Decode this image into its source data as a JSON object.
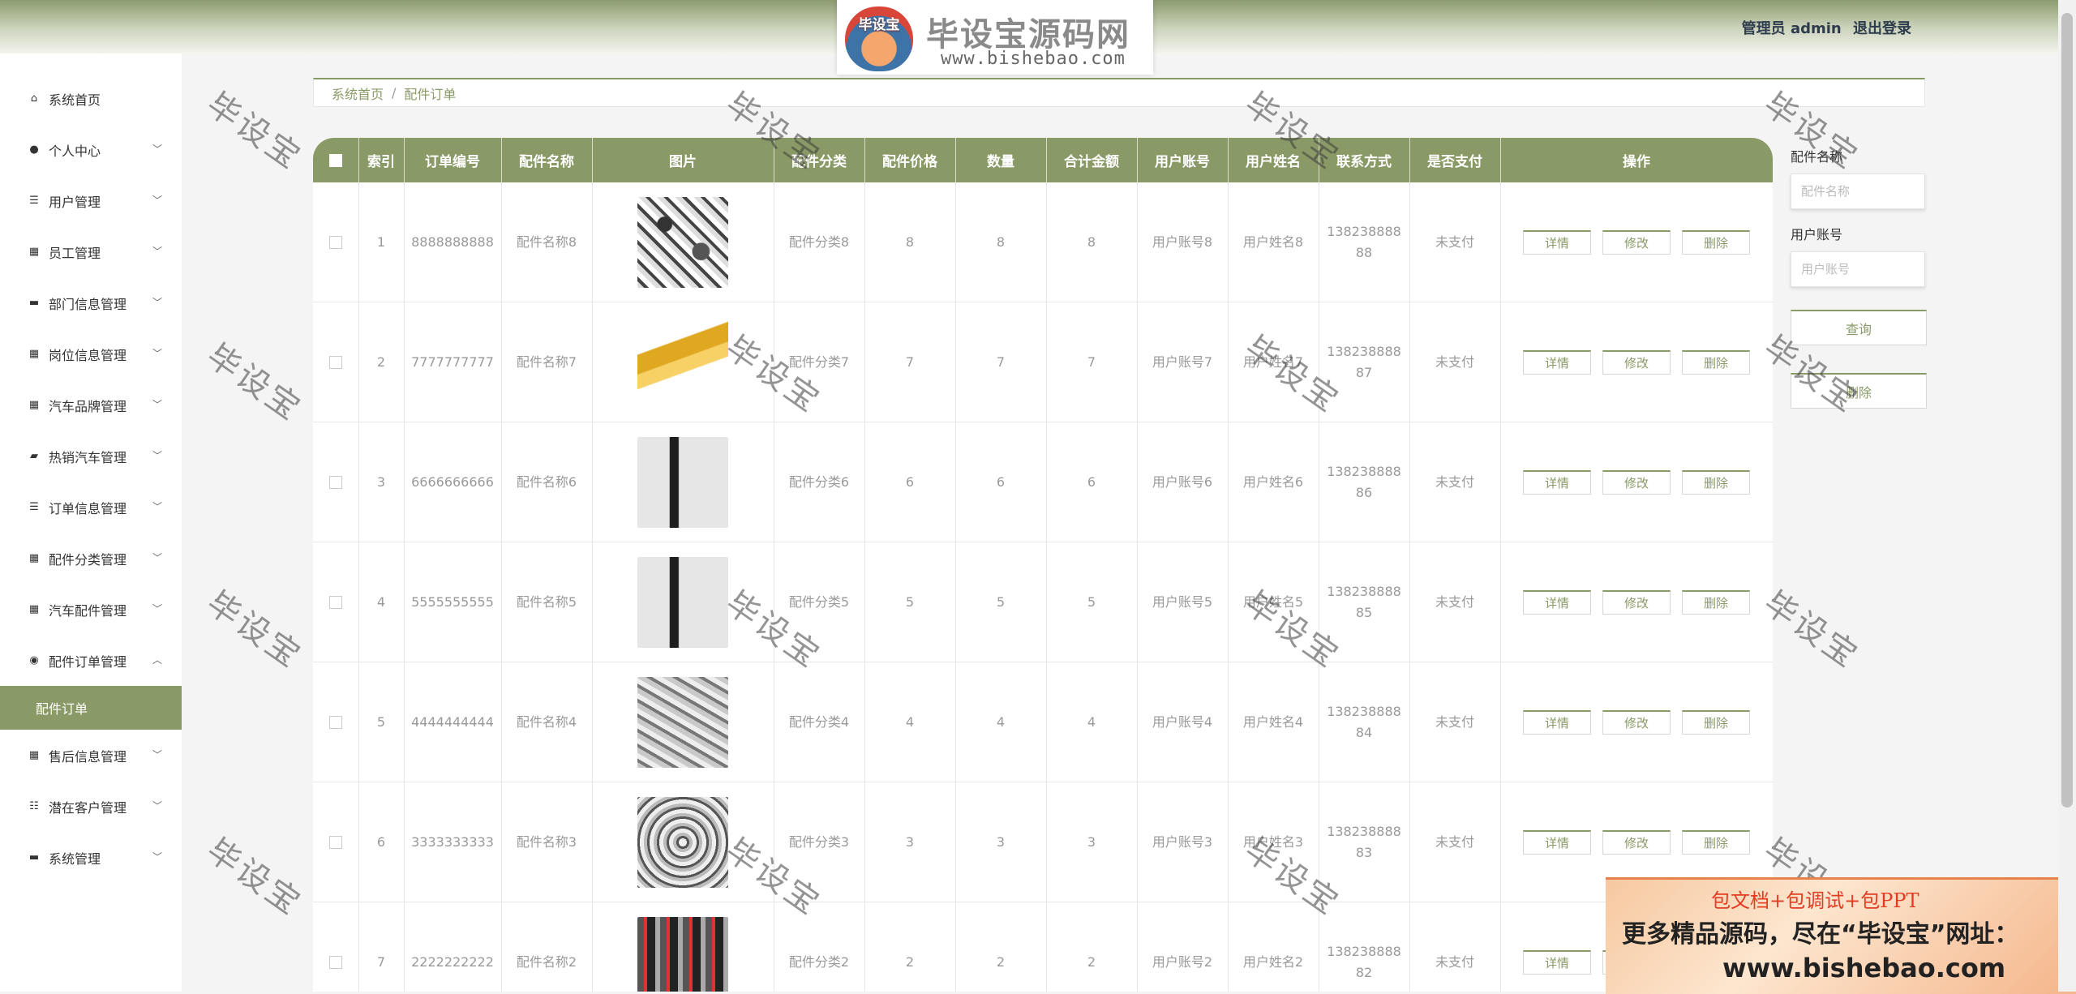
{
  "header": {
    "logo_badge": "毕设宝",
    "logo_title": "毕设宝源码网",
    "logo_url": "www.bishebao.com",
    "user_label": "管理员 admin",
    "logout_label": "退出登录"
  },
  "sidebar": {
    "items": [
      {
        "label": "系统首页",
        "icon": "home-icon",
        "glyph": "⌂",
        "chevron": false
      },
      {
        "label": "个人中心",
        "icon": "user-icon",
        "glyph": "●",
        "chevron": true
      },
      {
        "label": "用户管理",
        "icon": "list-icon",
        "glyph": "☰",
        "chevron": true
      },
      {
        "label": "员工管理",
        "icon": "chart-icon",
        "glyph": "▦",
        "chevron": true
      },
      {
        "label": "部门信息管理",
        "icon": "ticket-icon",
        "glyph": "▬",
        "chevron": true
      },
      {
        "label": "岗位信息管理",
        "icon": "grid-icon",
        "glyph": "▦",
        "chevron": true
      },
      {
        "label": "汽车品牌管理",
        "icon": "grid-icon",
        "glyph": "▦",
        "chevron": true
      },
      {
        "label": "热销汽车管理",
        "icon": "comment-icon",
        "glyph": "▰",
        "chevron": true
      },
      {
        "label": "订单信息管理",
        "icon": "list-icon",
        "glyph": "☰",
        "chevron": true
      },
      {
        "label": "配件分类管理",
        "icon": "grid-icon",
        "glyph": "▦",
        "chevron": true
      },
      {
        "label": "汽车配件管理",
        "icon": "grid-icon",
        "glyph": "▦",
        "chevron": true
      },
      {
        "label": "配件订单管理",
        "icon": "pin-icon",
        "glyph": "◉",
        "chevron": "up"
      }
    ],
    "active_sub": "配件订单",
    "items_after": [
      {
        "label": "售后信息管理",
        "icon": "grid-icon",
        "glyph": "▦",
        "chevron": true
      },
      {
        "label": "潜在客户管理",
        "icon": "sliders-icon",
        "glyph": "☷",
        "chevron": true
      },
      {
        "label": "系统管理",
        "icon": "flag-icon",
        "glyph": "▬",
        "chevron": true
      }
    ]
  },
  "breadcrumb": {
    "home": "系统首页",
    "separator": "/",
    "current": "配件订单"
  },
  "table": {
    "headers": [
      "索引",
      "订单编号",
      "配件名称",
      "图片",
      "配件分类",
      "配件价格",
      "数量",
      "合计金额",
      "用户账号",
      "用户姓名",
      "联系方式",
      "是否支付",
      "操作"
    ],
    "rows": [
      {
        "index": "1",
        "order_no": "8888888888",
        "name": "配件名称8",
        "image": "t1",
        "category": "配件分类8",
        "price": "8",
        "qty": "8",
        "total": "8",
        "account": "用户账号8",
        "username": "用户姓名8",
        "phone1": "138238888",
        "phone2": "88",
        "paid": "未支付"
      },
      {
        "index": "2",
        "order_no": "7777777777",
        "name": "配件名称7",
        "image": "t2",
        "category": "配件分类7",
        "price": "7",
        "qty": "7",
        "total": "7",
        "account": "用户账号7",
        "username": "用户姓名7",
        "phone1": "138238888",
        "phone2": "87",
        "paid": "未支付"
      },
      {
        "index": "3",
        "order_no": "6666666666",
        "name": "配件名称6",
        "image": "t3",
        "category": "配件分类6",
        "price": "6",
        "qty": "6",
        "total": "6",
        "account": "用户账号6",
        "username": "用户姓名6",
        "phone1": "138238888",
        "phone2": "86",
        "paid": "未支付"
      },
      {
        "index": "4",
        "order_no": "5555555555",
        "name": "配件名称5",
        "image": "t4",
        "category": "配件分类5",
        "price": "5",
        "qty": "5",
        "total": "5",
        "account": "用户账号5",
        "username": "用户姓名5",
        "phone1": "138238888",
        "phone2": "85",
        "paid": "未支付"
      },
      {
        "index": "5",
        "order_no": "4444444444",
        "name": "配件名称4",
        "image": "t5",
        "category": "配件分类4",
        "price": "4",
        "qty": "4",
        "total": "4",
        "account": "用户账号4",
        "username": "用户姓名4",
        "phone1": "138238888",
        "phone2": "84",
        "paid": "未支付"
      },
      {
        "index": "6",
        "order_no": "3333333333",
        "name": "配件名称3",
        "image": "t6",
        "category": "配件分类3",
        "price": "3",
        "qty": "3",
        "total": "3",
        "account": "用户账号3",
        "username": "用户姓名3",
        "phone1": "138238888",
        "phone2": "83",
        "paid": "未支付"
      },
      {
        "index": "7",
        "order_no": "2222222222",
        "name": "配件名称2",
        "image": "t7",
        "category": "配件分类2",
        "price": "2",
        "qty": "2",
        "total": "2",
        "account": "用户账号2",
        "username": "用户姓名2",
        "phone1": "138238888",
        "phone2": "82",
        "paid": "未支付"
      }
    ],
    "actions": {
      "detail": "详情",
      "edit": "修改",
      "delete": "删除"
    }
  },
  "search": {
    "name_label": "配件名称",
    "name_placeholder": "配件名称",
    "account_label": "用户账号",
    "account_placeholder": "用户账号",
    "query_button": "查询",
    "delete_button": "删除"
  },
  "watermark_text": "毕设宝",
  "ad": {
    "line1": "包文档+包调试+包PPT",
    "line2": "更多精品源码，尽在“毕设宝”网址：",
    "line3": "www.bishebao.com"
  },
  "colors": {
    "accent": "#8a9a67",
    "header_gradient_top": "#8c9b6f",
    "ad_red": "#e23c22"
  }
}
